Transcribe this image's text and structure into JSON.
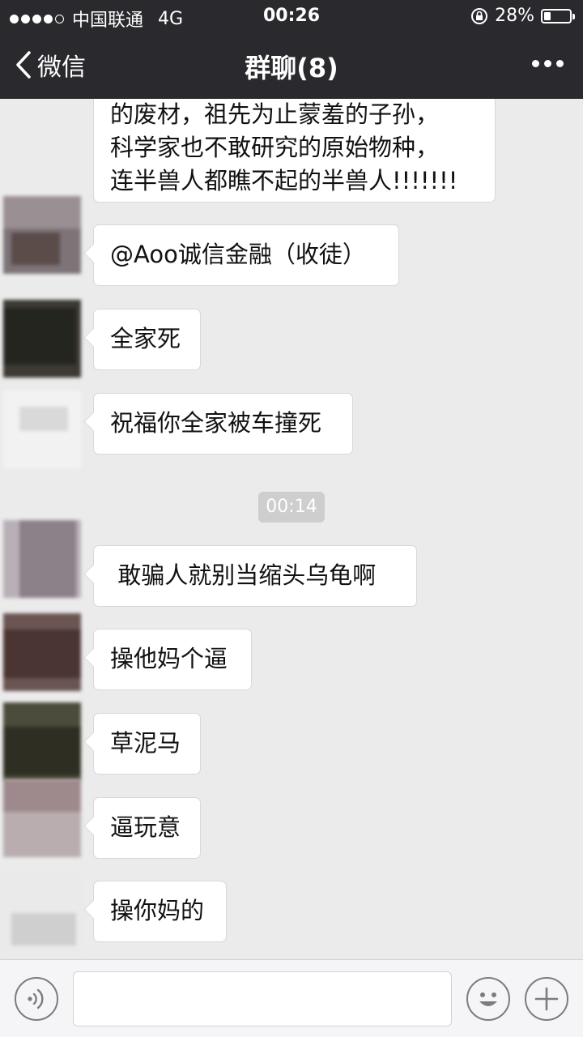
{
  "status_bar": {
    "carrier": "中国联通",
    "network": "4G",
    "time": "00:26",
    "battery_percent": "28%",
    "battery_level": 0.28,
    "signal_bars_filled": 4,
    "signal_bars_total": 5
  },
  "nav": {
    "back_label": "微信",
    "title": "群聊(8)"
  },
  "messages": [
    {
      "text": "的废材，祖先为止蒙羞的子孙，\n科学家也不敢研究的原始物种，\n连半兽人都瞧不起的半兽人!!!!!!!"
    },
    {
      "text": "@Aoo诚信金融（收徒）"
    },
    {
      "text": "全家死"
    },
    {
      "text": "祝福你全家被车撞死"
    },
    {
      "text": " 敢骗人就别当缩头乌龟啊"
    },
    {
      "text": "操他妈个逼"
    },
    {
      "text": "草泥马"
    },
    {
      "text": "逼玩意"
    },
    {
      "text": "操你妈的"
    }
  ],
  "timestamp": "00:14",
  "input_bar": {
    "voice_icon": "voice-icon",
    "emoji_icon": "emoji-icon",
    "plus_icon": "plus-icon",
    "text_value": ""
  },
  "colors": {
    "bar_bg": "#2a2a2e",
    "chat_bg": "#ebebeb",
    "bubble_bg": "#ffffff",
    "timestamp_bg": "#cecece"
  }
}
